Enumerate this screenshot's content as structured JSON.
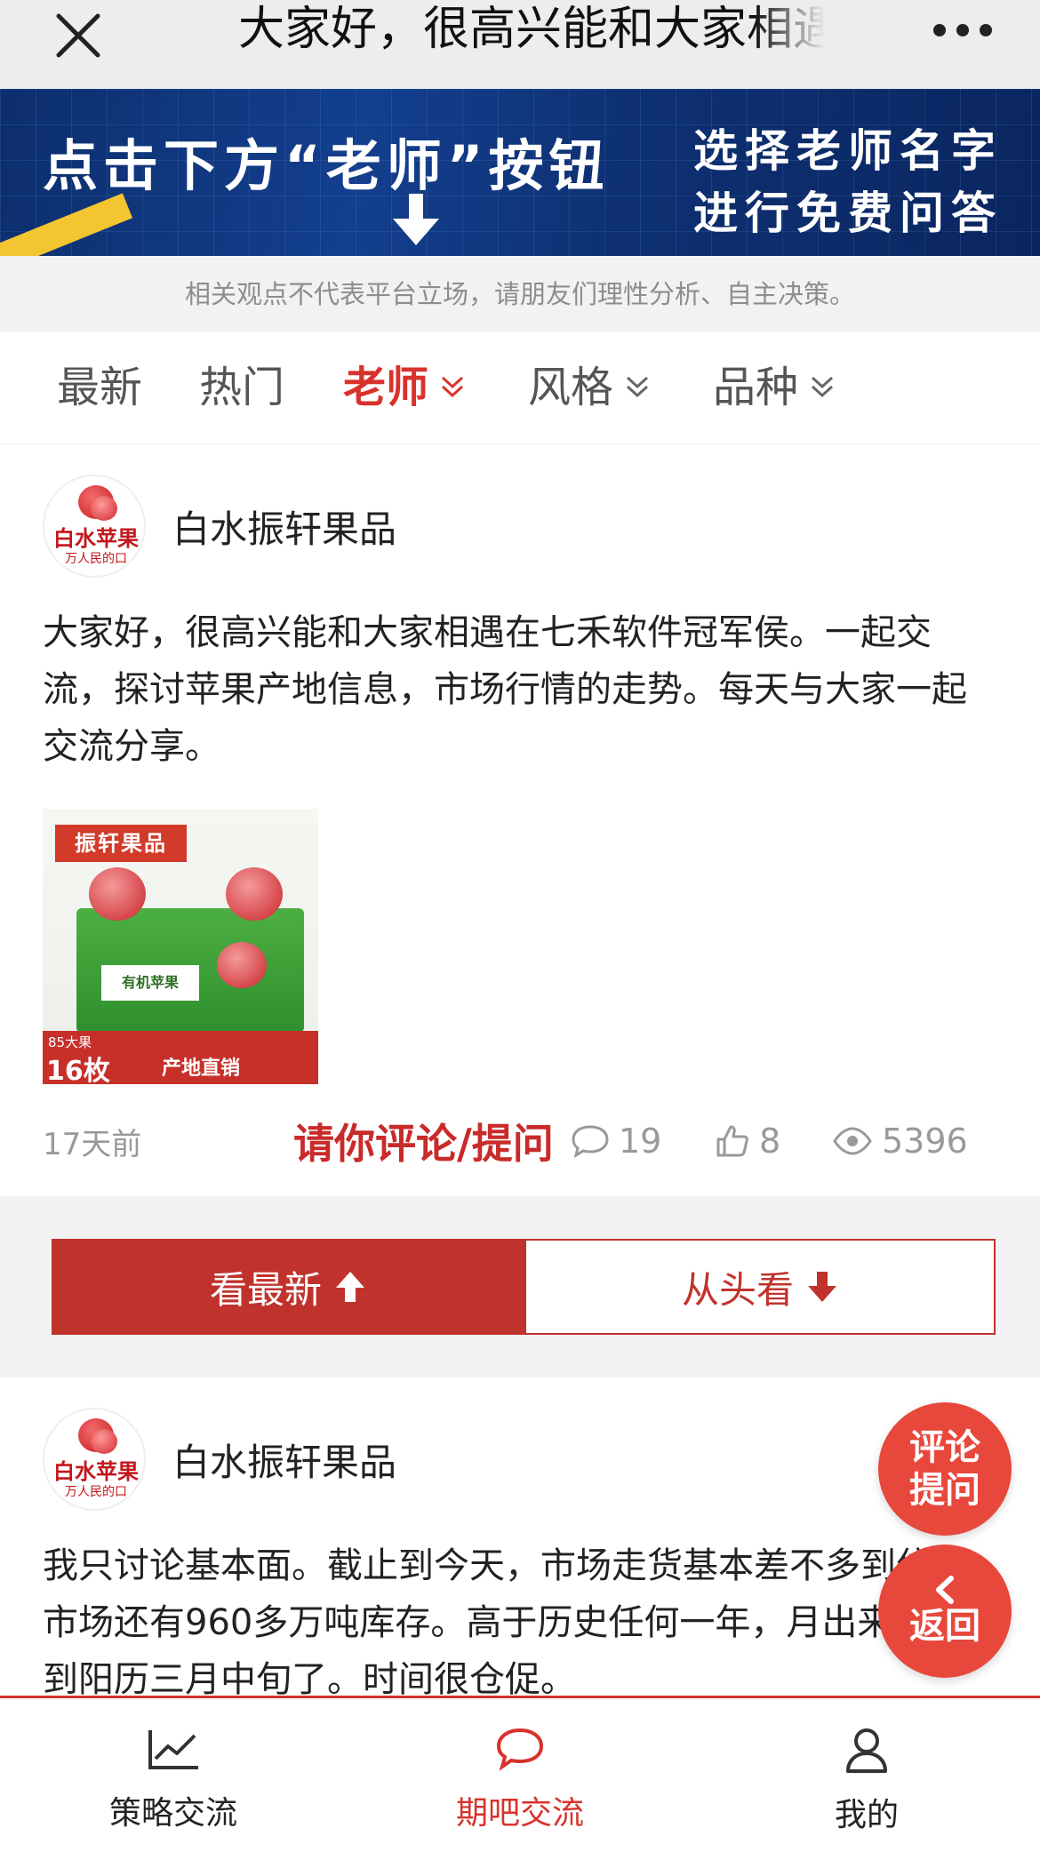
{
  "topbar": {
    "title": "大家好，很高兴能和大家相遇在七禾软件冠军侯。一起交流，探讨苹果产地信息，市场行情的走势。每天与大家一起交流分享。",
    "close_icon": "close-icon",
    "more_icon": "more-icon"
  },
  "banner": {
    "left_text": "点击下方“老师”按钮",
    "right_line1": "选择老师名字",
    "right_line2": "进行免费问答",
    "accent": "#f2c531"
  },
  "disclaimer": "相关观点不代表平台立场，请朋友们理性分析、自主决策。",
  "tabs": [
    {
      "label": "最新",
      "active": false,
      "dropdown": false
    },
    {
      "label": "热门",
      "active": false,
      "dropdown": false
    },
    {
      "label": "老师",
      "active": true,
      "dropdown": true
    },
    {
      "label": "风格",
      "active": false,
      "dropdown": true
    },
    {
      "label": "品种",
      "active": false,
      "dropdown": true
    }
  ],
  "posts": [
    {
      "author": "白水振轩果品",
      "avatar_text": "白水苹果",
      "avatar_sub": "万人民的口",
      "content": "大家好，很高兴能和大家相遇在七禾软件冠军侯。一起交流，探讨苹果产地信息，市场行情的走势。每天与大家一起交流分享。",
      "image": {
        "tag": "振轩果品",
        "box_label": "有机苹果",
        "count_small": "85大果",
        "count_big": "16枚",
        "direct": "产地直销"
      },
      "time": "17天前",
      "ask_label": "请你评论/提问",
      "comments": "19",
      "likes": "8",
      "views": "5396"
    },
    {
      "author": "白水振轩果品",
      "avatar_text": "白水苹果",
      "avatar_sub": "万人民的口",
      "content": "我只讨论基本面。截止到今天，市场走货基本差不多到位。市场还有960多万吨库存。高于历史任何一年，月出来，就到阳历三月中旬了。时间很仓促。"
    }
  ],
  "buttons": {
    "latest": "看最新",
    "from_start": "从头看"
  },
  "fab": {
    "comment_line1": "评论",
    "comment_line2": "提问",
    "back": "返回"
  },
  "bottom_nav": [
    {
      "label": "策略交流",
      "icon": "chart-icon",
      "active": false
    },
    {
      "label": "期吧交流",
      "icon": "chat-icon",
      "active": true
    },
    {
      "label": "我的",
      "icon": "user-icon",
      "active": false
    }
  ],
  "colors": {
    "brand_red": "#d8322c",
    "button_red": "#c0332c",
    "fab_red": "#e8473c"
  }
}
